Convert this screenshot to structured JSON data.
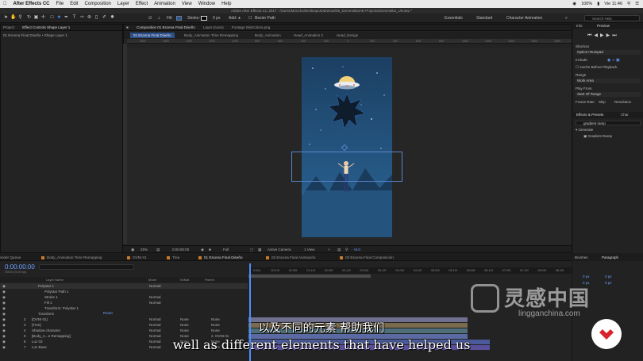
{
  "menubar": {
    "app_name": "After Effects CC",
    "items": [
      "File",
      "Edit",
      "Composition",
      "Layer",
      "Effect",
      "Animation",
      "View",
      "Window",
      "Help"
    ],
    "battery": "100%",
    "clock": "Vie 11:46"
  },
  "window_title": "Adobe After Effects CC 2017 - /Users/Moncho/Desktop/JOB/2018/05_Domestika/AE Projects/Domestika_U6.aep *",
  "toolbar": {
    "fill_label": "Fill:",
    "stroke_label": "Stroke:",
    "stroke_width": "0 px",
    "add_label": "Add:",
    "bezier_label": "Bezier Path",
    "workspaces": [
      "Essentials",
      "Standard",
      "Character Animation"
    ],
    "search_placeholder": "Search Help"
  },
  "left_panel": {
    "tabs": [
      "Project",
      "Effect Controls Shape Layer 1"
    ],
    "breadcrumb": "01 Escena Final Diseño • Shape Layer 1"
  },
  "viewer": {
    "tabs": [
      "Composition 01 Escena Final Diseño",
      "Layer (none)",
      "Footage SkinColors.png"
    ],
    "subtabs": [
      "01 Escena Final Diseño",
      "Body_Animation Time Remapping",
      "Body_Animation",
      "Head_Animation 2",
      "Head_Design"
    ],
    "ruler_marks": [
      "1800",
      "1600",
      "1400",
      "1200",
      "1000",
      "800",
      "600",
      "400",
      "200",
      "0",
      "200",
      "400",
      "600",
      "800",
      "1000",
      "1200",
      "1400",
      "1600",
      "1800"
    ],
    "zoom": "25%",
    "timecode": "0:00:50:00",
    "resolution": "Full",
    "camera": "Active Camera",
    "views": "1 View",
    "exposure": "+0.0"
  },
  "right_panel": {
    "info_tab": "Info",
    "preview_tab": "Preview",
    "shortcut_label": "Shortcut",
    "shortcut_value": "Option+Numpad",
    "include_label": "Include:",
    "cache_label": "Cache Before Playback",
    "range_label": "Range",
    "range_value": "Work Area",
    "play_from_label": "Play From",
    "play_from_value": "Start Of Range",
    "frame_rate_label": "Frame Rate",
    "skip_label": "Skip",
    "resolution_label": "Resolution",
    "effects_tab": "Effects & Presets",
    "char_tab": "Char",
    "effects_search": "gradient ramp",
    "generate_label": "Generate",
    "gradient_ramp": "Gradient Ramp"
  },
  "timeline": {
    "tabs": [
      "Render Queue",
      "Body_Animation Time Remapping",
      "OVNI 01",
      "Tree",
      "01 Escena Final Diseño",
      "02 Escena Final Animación",
      "03 Escena Final Composición"
    ],
    "tab_colors": [
      "#7a7a7a",
      "#c97a2a",
      "#c97a2a",
      "#c97a2a",
      "#c97a2a",
      "#c97a2a",
      "#c97a2a"
    ],
    "timecode": "0:00:00:00",
    "fps": "00000 (25.00 fps)",
    "columns": {
      "layer_name": "Layer Name",
      "mode": "Mode",
      "trkmat": "TrkMat",
      "parent": "Parent"
    },
    "time_marks": [
      "0:00s",
      "00:12f",
      "01:00f",
      "01:12f",
      "02:00f",
      "02:12f",
      "03:00f",
      "03:12f",
      "04:00f",
      "04:12f",
      "05:00f",
      "05:12f",
      "06:00f",
      "06:12f",
      "07:00f",
      "07:12f",
      "08:00f",
      "08:12f"
    ],
    "rows": [
      {
        "num": "",
        "name": "Polystar 1",
        "mode": "Normal",
        "trk": "",
        "parent": ""
      },
      {
        "num": "",
        "name": "Polystar Path 1",
        "mode": "",
        "trk": "",
        "parent": ""
      },
      {
        "num": "",
        "name": "Stroke 1",
        "mode": "Normal",
        "trk": "",
        "parent": ""
      },
      {
        "num": "",
        "name": "Fill 1",
        "mode": "Normal",
        "trk": "",
        "parent": ""
      },
      {
        "num": "",
        "name": "Transform: Polystar 1",
        "mode": "",
        "trk": "",
        "parent": ""
      },
      {
        "num": "",
        "name": "Transform",
        "mode": "",
        "trk": "",
        "parent": ""
      },
      {
        "num": "2",
        "name": "[OVNI 01]",
        "mode": "Normal",
        "trk": "None",
        "parent": "None"
      },
      {
        "num": "3",
        "name": "[Tree]",
        "mode": "Normal",
        "trk": "None",
        "parent": "None"
      },
      {
        "num": "4",
        "name": "Shadow character",
        "mode": "Normal",
        "trk": "None",
        "parent": "None"
      },
      {
        "num": "5",
        "name": "[Body_A...e Remapping]",
        "mode": "Normal",
        "trk": "None",
        "parent": "2. OVNI 01"
      },
      {
        "num": "6",
        "name": "Luz 03",
        "mode": "Normal",
        "trk": "None",
        "parent": "None"
      },
      {
        "num": "7",
        "name": "Luz Base",
        "mode": "Normal",
        "trk": "None",
        "parent": "None"
      }
    ],
    "reset_label": "Reset"
  },
  "bottom_right": {
    "tabs": [
      "Brushes",
      "Paragraph"
    ],
    "values": [
      "0 px",
      "0 px",
      "0 px",
      "0 px"
    ]
  },
  "subtitles": {
    "zh": "以及不同的元素 帮助我们",
    "en": "well as different elements that have helped us"
  },
  "watermark": {
    "main": "灵感中国",
    "sub": "lingganchina.com"
  }
}
